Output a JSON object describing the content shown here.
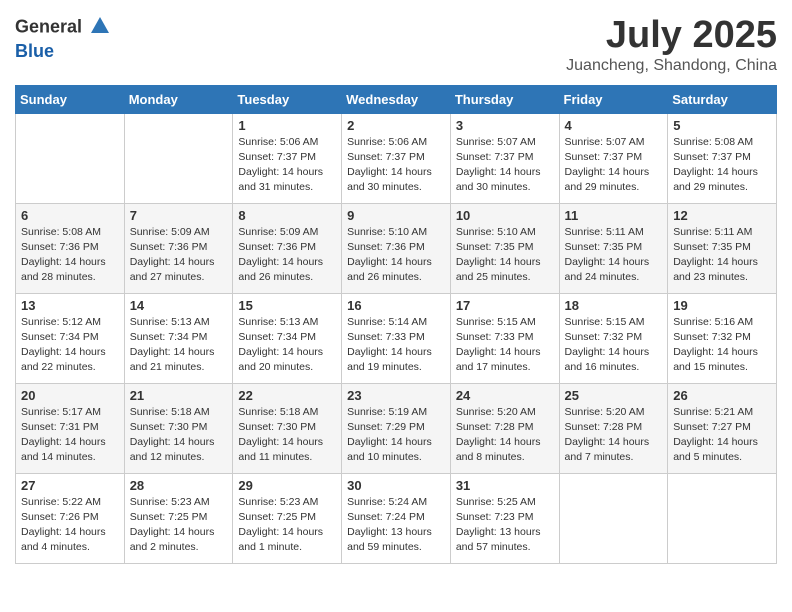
{
  "header": {
    "logo_general": "General",
    "logo_blue": "Blue",
    "month_year": "July 2025",
    "location": "Juancheng, Shandong, China"
  },
  "weekdays": [
    "Sunday",
    "Monday",
    "Tuesday",
    "Wednesday",
    "Thursday",
    "Friday",
    "Saturday"
  ],
  "weeks": [
    [
      {
        "day": "",
        "info": ""
      },
      {
        "day": "",
        "info": ""
      },
      {
        "day": "1",
        "info": "Sunrise: 5:06 AM\nSunset: 7:37 PM\nDaylight: 14 hours\nand 31 minutes."
      },
      {
        "day": "2",
        "info": "Sunrise: 5:06 AM\nSunset: 7:37 PM\nDaylight: 14 hours\nand 30 minutes."
      },
      {
        "day": "3",
        "info": "Sunrise: 5:07 AM\nSunset: 7:37 PM\nDaylight: 14 hours\nand 30 minutes."
      },
      {
        "day": "4",
        "info": "Sunrise: 5:07 AM\nSunset: 7:37 PM\nDaylight: 14 hours\nand 29 minutes."
      },
      {
        "day": "5",
        "info": "Sunrise: 5:08 AM\nSunset: 7:37 PM\nDaylight: 14 hours\nand 29 minutes."
      }
    ],
    [
      {
        "day": "6",
        "info": "Sunrise: 5:08 AM\nSunset: 7:36 PM\nDaylight: 14 hours\nand 28 minutes."
      },
      {
        "day": "7",
        "info": "Sunrise: 5:09 AM\nSunset: 7:36 PM\nDaylight: 14 hours\nand 27 minutes."
      },
      {
        "day": "8",
        "info": "Sunrise: 5:09 AM\nSunset: 7:36 PM\nDaylight: 14 hours\nand 26 minutes."
      },
      {
        "day": "9",
        "info": "Sunrise: 5:10 AM\nSunset: 7:36 PM\nDaylight: 14 hours\nand 26 minutes."
      },
      {
        "day": "10",
        "info": "Sunrise: 5:10 AM\nSunset: 7:35 PM\nDaylight: 14 hours\nand 25 minutes."
      },
      {
        "day": "11",
        "info": "Sunrise: 5:11 AM\nSunset: 7:35 PM\nDaylight: 14 hours\nand 24 minutes."
      },
      {
        "day": "12",
        "info": "Sunrise: 5:11 AM\nSunset: 7:35 PM\nDaylight: 14 hours\nand 23 minutes."
      }
    ],
    [
      {
        "day": "13",
        "info": "Sunrise: 5:12 AM\nSunset: 7:34 PM\nDaylight: 14 hours\nand 22 minutes."
      },
      {
        "day": "14",
        "info": "Sunrise: 5:13 AM\nSunset: 7:34 PM\nDaylight: 14 hours\nand 21 minutes."
      },
      {
        "day": "15",
        "info": "Sunrise: 5:13 AM\nSunset: 7:34 PM\nDaylight: 14 hours\nand 20 minutes."
      },
      {
        "day": "16",
        "info": "Sunrise: 5:14 AM\nSunset: 7:33 PM\nDaylight: 14 hours\nand 19 minutes."
      },
      {
        "day": "17",
        "info": "Sunrise: 5:15 AM\nSunset: 7:33 PM\nDaylight: 14 hours\nand 17 minutes."
      },
      {
        "day": "18",
        "info": "Sunrise: 5:15 AM\nSunset: 7:32 PM\nDaylight: 14 hours\nand 16 minutes."
      },
      {
        "day": "19",
        "info": "Sunrise: 5:16 AM\nSunset: 7:32 PM\nDaylight: 14 hours\nand 15 minutes."
      }
    ],
    [
      {
        "day": "20",
        "info": "Sunrise: 5:17 AM\nSunset: 7:31 PM\nDaylight: 14 hours\nand 14 minutes."
      },
      {
        "day": "21",
        "info": "Sunrise: 5:18 AM\nSunset: 7:30 PM\nDaylight: 14 hours\nand 12 minutes."
      },
      {
        "day": "22",
        "info": "Sunrise: 5:18 AM\nSunset: 7:30 PM\nDaylight: 14 hours\nand 11 minutes."
      },
      {
        "day": "23",
        "info": "Sunrise: 5:19 AM\nSunset: 7:29 PM\nDaylight: 14 hours\nand 10 minutes."
      },
      {
        "day": "24",
        "info": "Sunrise: 5:20 AM\nSunset: 7:28 PM\nDaylight: 14 hours\nand 8 minutes."
      },
      {
        "day": "25",
        "info": "Sunrise: 5:20 AM\nSunset: 7:28 PM\nDaylight: 14 hours\nand 7 minutes."
      },
      {
        "day": "26",
        "info": "Sunrise: 5:21 AM\nSunset: 7:27 PM\nDaylight: 14 hours\nand 5 minutes."
      }
    ],
    [
      {
        "day": "27",
        "info": "Sunrise: 5:22 AM\nSunset: 7:26 PM\nDaylight: 14 hours\nand 4 minutes."
      },
      {
        "day": "28",
        "info": "Sunrise: 5:23 AM\nSunset: 7:25 PM\nDaylight: 14 hours\nand 2 minutes."
      },
      {
        "day": "29",
        "info": "Sunrise: 5:23 AM\nSunset: 7:25 PM\nDaylight: 14 hours\nand 1 minute."
      },
      {
        "day": "30",
        "info": "Sunrise: 5:24 AM\nSunset: 7:24 PM\nDaylight: 13 hours\nand 59 minutes."
      },
      {
        "day": "31",
        "info": "Sunrise: 5:25 AM\nSunset: 7:23 PM\nDaylight: 13 hours\nand 57 minutes."
      },
      {
        "day": "",
        "info": ""
      },
      {
        "day": "",
        "info": ""
      }
    ]
  ]
}
